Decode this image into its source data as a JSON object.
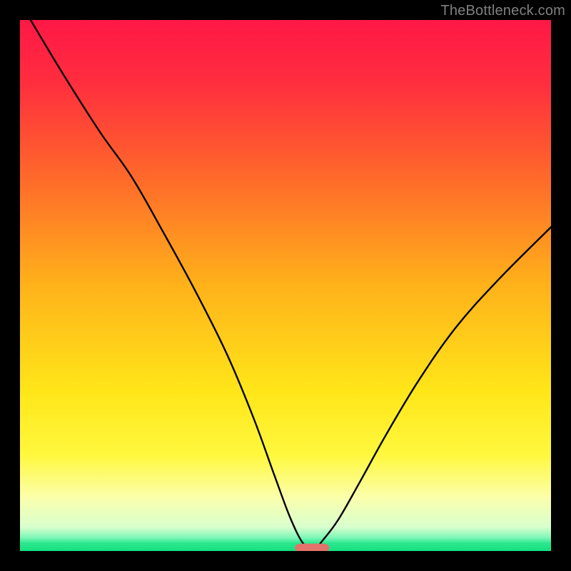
{
  "watermark": "TheBottleneck.com",
  "chart_data": {
    "type": "line",
    "title": "",
    "xlabel": "",
    "ylabel": "",
    "xlim": [
      0,
      100
    ],
    "ylim": [
      0,
      100
    ],
    "gradient_stops": [
      {
        "offset": 0.0,
        "color": "#ff1846"
      },
      {
        "offset": 0.12,
        "color": "#ff2e3e"
      },
      {
        "offset": 0.3,
        "color": "#ff6a2a"
      },
      {
        "offset": 0.5,
        "color": "#ffb21a"
      },
      {
        "offset": 0.7,
        "color": "#ffe619"
      },
      {
        "offset": 0.82,
        "color": "#fff83e"
      },
      {
        "offset": 0.9,
        "color": "#fbffad"
      },
      {
        "offset": 0.955,
        "color": "#d8ffcd"
      },
      {
        "offset": 0.975,
        "color": "#7cf7b7"
      },
      {
        "offset": 0.985,
        "color": "#2de78f"
      },
      {
        "offset": 1.0,
        "color": "#14e07e"
      }
    ],
    "series": [
      {
        "name": "bottleneck-curve",
        "x": [
          2,
          8,
          15,
          21,
          27,
          33,
          39,
          44,
          48,
          51,
          53.5,
          55.5,
          57,
          60,
          64,
          69,
          75,
          82,
          90,
          100
        ],
        "y": [
          100,
          90,
          79,
          70.5,
          60,
          49,
          37,
          25,
          14,
          6,
          1.2,
          0.5,
          2,
          6,
          13,
          22,
          32,
          42,
          51,
          61
        ]
      }
    ],
    "marker": {
      "name": "optimal-marker",
      "x_center": 55,
      "y": 0.6,
      "width": 6.5,
      "height": 1.6,
      "rx": 1.0,
      "color": "#e2736a"
    }
  }
}
